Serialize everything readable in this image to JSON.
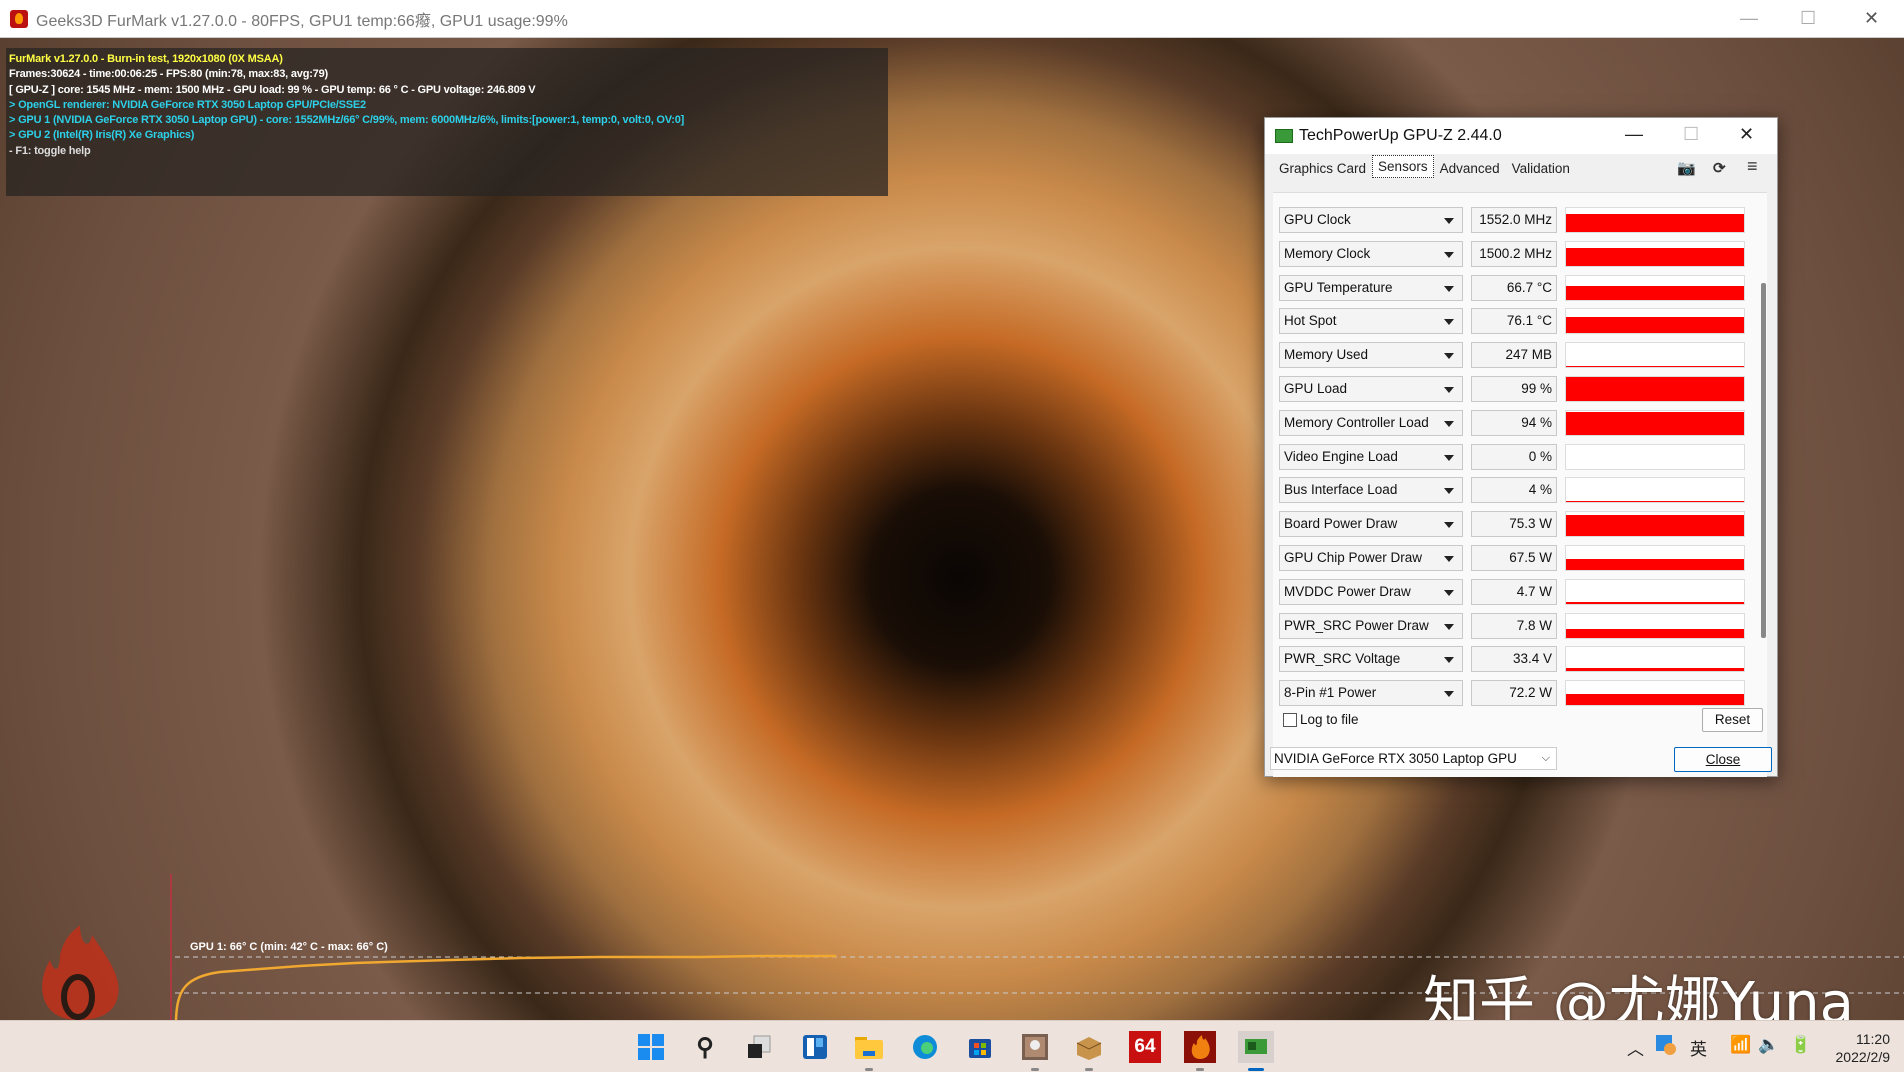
{
  "furmark": {
    "title": "Geeks3D FurMark v1.27.0.0 - 80FPS, GPU1 temp:66癈, GPU1 usage:99%",
    "overlay": [
      "FurMark v1.27.0.0 - Burn-in test, 1920x1080 (0X MSAA)",
      "Frames:30624 - time:00:06:25 - FPS:80 (min:78, max:83, avg:79)",
      "[ GPU-Z ] core: 1545 MHz - mem: 1500 MHz - GPU load: 99 % - GPU temp: 66 ° C - GPU voltage: 246.809 V",
      "> OpenGL renderer: NVIDIA GeForce RTX 3050 Laptop GPU/PCIe/SSE2",
      "> GPU 1 (NVIDIA GeForce RTX 3050 Laptop GPU) - core: 1552MHz/66° C/99%, mem: 6000MHz/6%, limits:[power:1, temp:0, volt:0, OV:0]",
      "> GPU 2 (Intel(R) Iris(R) Xe Graphics)",
      "- F1: toggle help"
    ],
    "temp_graph_label": "GPU 1: 66° C (min: 42° C - max: 66° C)",
    "line_color": "#f0a830"
  },
  "gpuz": {
    "title": "TechPowerUp GPU-Z 2.44.0",
    "tabs": [
      "Graphics Card",
      "Sensors",
      "Advanced",
      "Validation"
    ],
    "active_tab": "Sensors",
    "bar_color": "#ff0000",
    "sensors": [
      {
        "name": "GPU Clock",
        "value": "1552.0 MHz",
        "level": 0.75
      },
      {
        "name": "Memory Clock",
        "value": "1500.2 MHz",
        "level": 0.75
      },
      {
        "name": "GPU Temperature",
        "value": "66.7 °C",
        "level": 0.55
      },
      {
        "name": "Hot Spot",
        "value": "76.1 °C",
        "level": 0.7
      },
      {
        "name": "Memory Used",
        "value": "247 MB",
        "level": 0.04
      },
      {
        "name": "GPU Load",
        "value": "99 %",
        "level": 0.99
      },
      {
        "name": "Memory Controller Load",
        "value": "94 %",
        "level": 0.94
      },
      {
        "name": "Video Engine Load",
        "value": "0 %",
        "level": 0
      },
      {
        "name": "Bus Interface Load",
        "value": "4 %",
        "level": 0.04
      },
      {
        "name": "Board Power Draw",
        "value": "75.3 W",
        "level": 0.9
      },
      {
        "name": "GPU Chip Power Draw",
        "value": "67.5 W",
        "level": 0.45
      },
      {
        "name": "MVDDC Power Draw",
        "value": "4.7 W",
        "level": 0.08
      },
      {
        "name": "PWR_SRC Power Draw",
        "value": "7.8 W",
        "level": 0.35
      },
      {
        "name": "PWR_SRC Voltage",
        "value": "33.4 V",
        "level": 0.15
      },
      {
        "name": "8-Pin #1 Power",
        "value": "72.2 W",
        "level": 0.45
      }
    ],
    "log_to_file": "Log to file",
    "reset": "Reset",
    "gpu_select": "NVIDIA GeForce RTX 3050 Laptop GPU",
    "close": "Close"
  },
  "watermark": "知乎 @尤娜Yuna",
  "taskbar": {
    "apps": [
      "windows-start",
      "search",
      "task-view",
      "widgets",
      "file-explorer",
      "edge",
      "store",
      "app-photo",
      "app-package",
      "aida64",
      "furmark",
      "gpu-z"
    ],
    "aida_label": "64",
    "ime": "英",
    "time": "11:20",
    "date": "2022/2/9"
  }
}
